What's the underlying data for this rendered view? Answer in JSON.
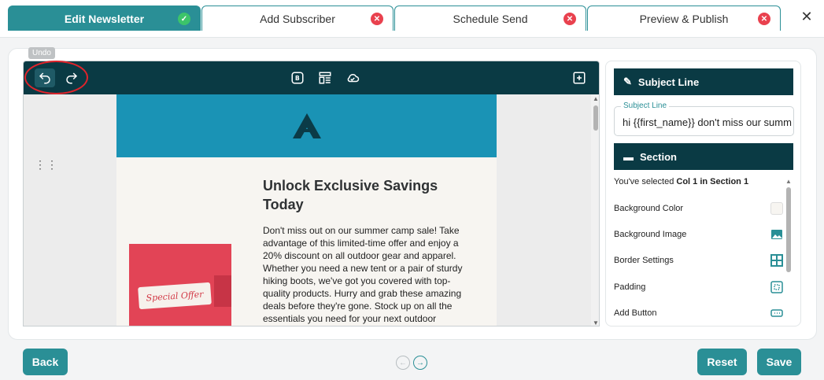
{
  "tabs": [
    {
      "label": "Edit Newsletter",
      "status": "complete"
    },
    {
      "label": "Add Subscriber",
      "status": "error"
    },
    {
      "label": "Schedule Send",
      "status": "error"
    },
    {
      "label": "Preview & Publish",
      "status": "error"
    }
  ],
  "close_glyph": "✕",
  "editor": {
    "tooltip": "Undo",
    "toolbar_icons": [
      "undo-icon",
      "redo-icon",
      "brand-icon",
      "layout-icon",
      "cloud-icon",
      "add-block-icon"
    ],
    "email": {
      "logo_letter": "A",
      "headline": "Unlock Exclusive Savings Today",
      "body": "Don't miss out on our summer camp sale! Take advantage of this limited-time offer and enjoy a 20% discount on all outdoor gear and apparel. Whether you need a new tent or a pair of sturdy hiking boots, we've got you covered with top-quality products. Hurry and grab these amazing deals before they're gone. Stock up on all the essentials you need for your next outdoor",
      "offer_text": "Special Offer"
    }
  },
  "panel": {
    "subject_header": "Subject Line",
    "subject_legend": "Subject Line",
    "subject_value": "hi {{first_name}} don't miss our summer sale",
    "section_header": "Section",
    "selected_prefix": "You've selected ",
    "selected_target": "Col 1 in Section 1",
    "settings": [
      {
        "label": "Background Color",
        "icon": "color-swatch-icon"
      },
      {
        "label": "Background Image",
        "icon": "image-icon"
      },
      {
        "label": "Border Settings",
        "icon": "border-icon"
      },
      {
        "label": "Padding",
        "icon": "padding-icon"
      },
      {
        "label": "Add Button",
        "icon": "button-icon"
      }
    ]
  },
  "footer": {
    "back": "Back",
    "reset": "Reset",
    "save": "Save"
  },
  "colors": {
    "accent": "#2a8f96",
    "toolbar": "#0a3a44",
    "email_header": "#1a93b5",
    "error": "#e9414e",
    "success": "#3cc46a"
  }
}
